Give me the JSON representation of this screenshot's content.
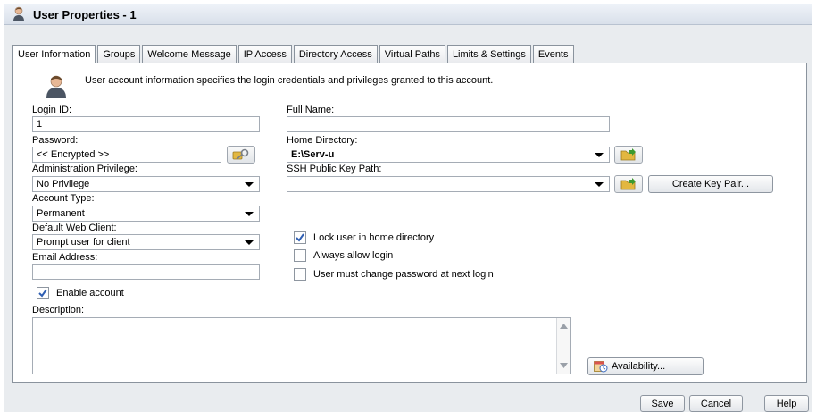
{
  "window": {
    "title": "User Properties - 1"
  },
  "tabs": [
    {
      "label": "User Information",
      "active": true
    },
    {
      "label": "Groups"
    },
    {
      "label": "Welcome Message"
    },
    {
      "label": "IP Access"
    },
    {
      "label": "Directory Access"
    },
    {
      "label": "Virtual Paths"
    },
    {
      "label": "Limits & Settings"
    },
    {
      "label": "Events"
    }
  ],
  "info": {
    "text": "User account information specifies the login credentials and privileges granted to this account."
  },
  "form": {
    "login_id": {
      "label": "Login ID:",
      "value": "1"
    },
    "full_name": {
      "label": "Full Name:",
      "value": ""
    },
    "password": {
      "label": "Password:",
      "value": "<< Encrypted >>"
    },
    "home_directory": {
      "label": "Home Directory:",
      "value": "E:\\Serv-u"
    },
    "admin_privilege": {
      "label": "Administration Privilege:",
      "value": "No Privilege"
    },
    "ssh_key_path": {
      "label": "SSH Public Key Path:",
      "value": ""
    },
    "account_type": {
      "label": "Account Type:",
      "value": "Permanent"
    },
    "web_client": {
      "label": "Default Web Client:",
      "value": "Prompt user for client"
    },
    "email": {
      "label": "Email Address:",
      "value": ""
    },
    "description": {
      "label": "Description:",
      "value": ""
    }
  },
  "checkboxes": {
    "lock_home": {
      "label": "Lock user in home directory",
      "checked": true
    },
    "always_allow": {
      "label": "Always allow login",
      "checked": false
    },
    "must_change_pw": {
      "label": "User must change password at next login",
      "checked": false
    },
    "enable_account": {
      "label": "Enable account",
      "checked": true
    }
  },
  "buttons": {
    "create_key_pair": "Create Key Pair...",
    "availability": "Availability...",
    "save": "Save",
    "cancel": "Cancel",
    "help": "Help"
  },
  "icons": {
    "title": "user-icon",
    "info": "user-icon",
    "password_generate": "key-icon",
    "browse": "folder-icon",
    "availability": "calendar-clock-icon",
    "check": "checkmark-icon",
    "caret": "chevron-down-icon"
  },
  "colors": {
    "check": "#2f5fb3",
    "folder": "#e3b740",
    "arrow": "#3c9a2f"
  }
}
